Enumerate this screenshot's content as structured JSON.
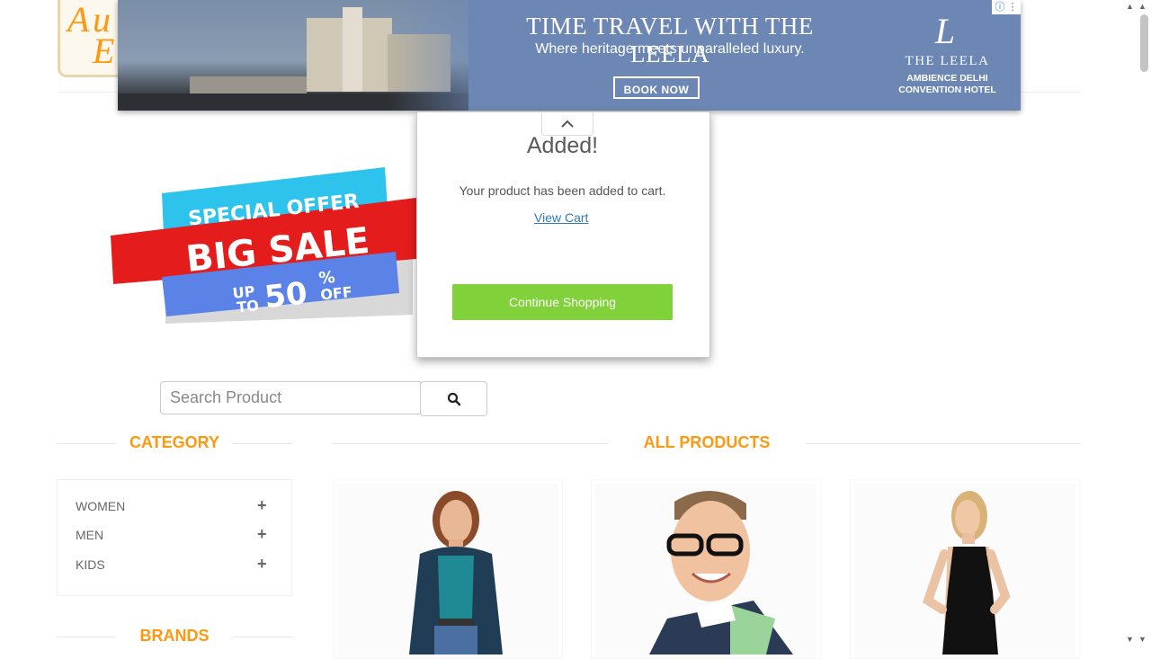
{
  "logo": {
    "alt_letters": [
      "A",
      "u",
      "E"
    ]
  },
  "ad": {
    "title": "TIME TRAVEL WITH THE LEELA",
    "subtitle": "Where heritage meets unparalleled luxury.",
    "cta": "BOOK NOW",
    "brand_mark": "L",
    "brand_name": "THE LEELA",
    "brand_location_1": "AMBIENCE DELHI",
    "brand_location_2": "CONVENTION HOTEL",
    "adchoices_icon": "info-icon",
    "menu_icon": "more-vert-icon"
  },
  "sale_banner": {
    "line1": "SPECIAL OFFER",
    "line2": "BIG SALE",
    "line3a": "UP",
    "line3b": "TO",
    "line3c": "50",
    "line3d": "%",
    "line3e": "OFF",
    "colors": {
      "cyan": "#2ec3ec",
      "red": "#e51c1c",
      "blue": "#5b82e6"
    }
  },
  "modal": {
    "title": "Added!",
    "message": "Your product has been added to cart.",
    "view_cart": "View Cart",
    "continue": "Continue Shopping",
    "collapse_icon": "chevron-up-icon"
  },
  "search": {
    "placeholder": "Search Product",
    "icon": "search-icon"
  },
  "category": {
    "heading": "CATEGORY",
    "items": [
      {
        "label": "WOMEN",
        "icon": "plus-icon"
      },
      {
        "label": "MEN",
        "icon": "plus-icon"
      },
      {
        "label": "KIDS",
        "icon": "plus-icon"
      }
    ]
  },
  "brands": {
    "heading": "BRANDS"
  },
  "products": {
    "heading": "ALL PRODUCTS",
    "items": [
      {
        "image": "woman-in-teal-top-photo"
      },
      {
        "image": "man-with-glasses-photo"
      },
      {
        "image": "woman-in-black-dress-photo"
      }
    ]
  },
  "colors": {
    "accent": "#fe980f",
    "button_green": "#80d13a",
    "link": "#337ab7"
  }
}
